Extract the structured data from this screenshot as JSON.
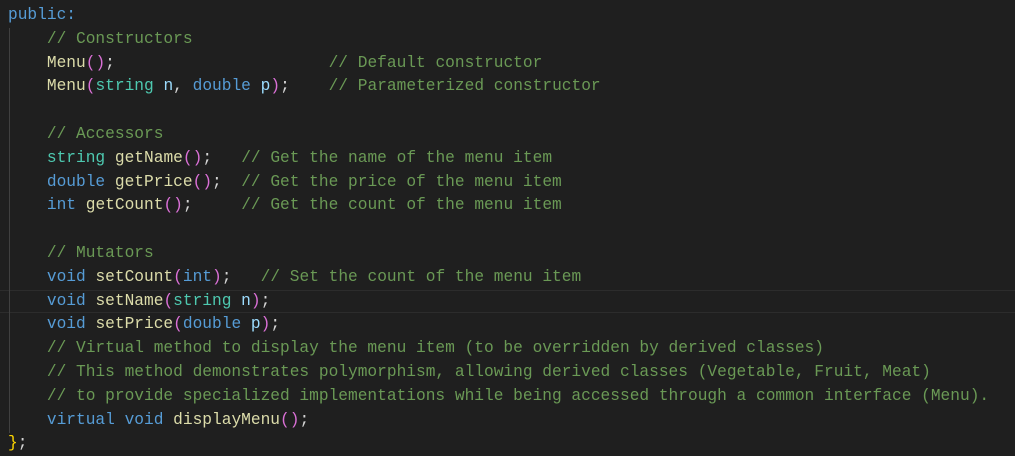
{
  "editor": {
    "background": "#1f1f1f",
    "current_line": 13,
    "lines": [
      [
        [
          "public",
          "kw"
        ],
        [
          ":",
          "kw"
        ]
      ],
      [
        [
          "    ",
          " punct"
        ],
        [
          "// Constructors",
          "cm"
        ]
      ],
      [
        [
          "    ",
          "punct"
        ],
        [
          "Menu",
          "fn"
        ],
        [
          "(",
          "p1"
        ],
        [
          ")",
          "p1"
        ],
        [
          ";",
          "punct"
        ],
        [
          "                      ",
          "punct"
        ],
        [
          "// Default constructor",
          "cm"
        ]
      ],
      [
        [
          "    ",
          "punct"
        ],
        [
          "Menu",
          "fn"
        ],
        [
          "(",
          "p1"
        ],
        [
          "string",
          "type"
        ],
        [
          " ",
          "punct"
        ],
        [
          "n",
          "param"
        ],
        [
          ", ",
          "punct"
        ],
        [
          "double",
          "kw"
        ],
        [
          " ",
          "punct"
        ],
        [
          "p",
          "param"
        ],
        [
          ")",
          "p1"
        ],
        [
          ";",
          "punct"
        ],
        [
          "    ",
          "punct"
        ],
        [
          "// Parameterized constructor",
          "cm"
        ]
      ],
      [],
      [
        [
          "    ",
          "punct"
        ],
        [
          "// Accessors",
          "cm"
        ]
      ],
      [
        [
          "    ",
          "punct"
        ],
        [
          "string",
          "type"
        ],
        [
          " ",
          "punct"
        ],
        [
          "getName",
          "fn"
        ],
        [
          "(",
          "p1"
        ],
        [
          ")",
          "p1"
        ],
        [
          ";",
          "punct"
        ],
        [
          "   ",
          "punct"
        ],
        [
          "// Get the name of the menu item",
          "cm"
        ]
      ],
      [
        [
          "    ",
          "punct"
        ],
        [
          "double",
          "kw"
        ],
        [
          " ",
          "punct"
        ],
        [
          "getPrice",
          "fn"
        ],
        [
          "(",
          "p1"
        ],
        [
          ")",
          "p1"
        ],
        [
          ";",
          "punct"
        ],
        [
          "  ",
          "punct"
        ],
        [
          "// Get the price of the menu item",
          "cm"
        ]
      ],
      [
        [
          "    ",
          "punct"
        ],
        [
          "int",
          "kw"
        ],
        [
          " ",
          "punct"
        ],
        [
          "getCount",
          "fn"
        ],
        [
          "(",
          "p1"
        ],
        [
          ")",
          "p1"
        ],
        [
          ";",
          "punct"
        ],
        [
          "     ",
          "punct"
        ],
        [
          "// Get the count of the menu item",
          "cm"
        ]
      ],
      [],
      [
        [
          "    ",
          "punct"
        ],
        [
          "// Mutators",
          "cm"
        ]
      ],
      [
        [
          "    ",
          "punct"
        ],
        [
          "void",
          "kw"
        ],
        [
          " ",
          "punct"
        ],
        [
          "setCount",
          "fn"
        ],
        [
          "(",
          "p1"
        ],
        [
          "int",
          "kw"
        ],
        [
          ")",
          "p1"
        ],
        [
          ";",
          "punct"
        ],
        [
          "   ",
          "punct"
        ],
        [
          "// Set the count of the menu item",
          "cm"
        ]
      ],
      [
        [
          "    ",
          "punct"
        ],
        [
          "void",
          "kw"
        ],
        [
          " ",
          "punct"
        ],
        [
          "setName",
          "fn"
        ],
        [
          "(",
          "p1"
        ],
        [
          "string",
          "type"
        ],
        [
          " ",
          "punct"
        ],
        [
          "n",
          "param"
        ],
        [
          ")",
          "p1"
        ],
        [
          ";",
          "punct"
        ]
      ],
      [
        [
          "    ",
          "punct"
        ],
        [
          "void",
          "kw"
        ],
        [
          " ",
          "punct"
        ],
        [
          "setPrice",
          "fn"
        ],
        [
          "(",
          "p1"
        ],
        [
          "double",
          "kw"
        ],
        [
          " ",
          "punct"
        ],
        [
          "p",
          "param"
        ],
        [
          ")",
          "p1"
        ],
        [
          ";",
          "punct"
        ]
      ],
      [
        [
          "    ",
          "punct"
        ],
        [
          "// Virtual method to display the menu item (to be overridden by derived classes)",
          "cm"
        ]
      ],
      [
        [
          "    ",
          "punct"
        ],
        [
          "// This method demonstrates polymorphism, allowing derived classes (Vegetable, Fruit, Meat)",
          "cm"
        ]
      ],
      [
        [
          "    ",
          "punct"
        ],
        [
          "// to provide specialized implementations while being accessed through a common interface (Menu).",
          "cm"
        ]
      ],
      [
        [
          "    ",
          "punct"
        ],
        [
          "virtual",
          "kw"
        ],
        [
          " ",
          "punct"
        ],
        [
          "void",
          "kw"
        ],
        [
          " ",
          "punct"
        ],
        [
          "displayMenu",
          "fn"
        ],
        [
          "(",
          "p1"
        ],
        [
          ")",
          "p1"
        ],
        [
          ";",
          "punct"
        ]
      ],
      [
        [
          "}",
          "p0"
        ],
        [
          ";",
          "punct"
        ]
      ]
    ]
  }
}
